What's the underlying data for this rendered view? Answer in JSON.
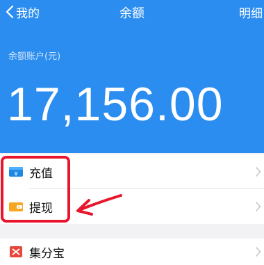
{
  "nav": {
    "back_label": "我的",
    "title": "余额",
    "detail_label": "明细"
  },
  "account": {
    "label": "余额账户(元)",
    "balance": "17,156.00"
  },
  "menu": {
    "items": [
      {
        "label": "充值",
        "icon": "wallet-card-icon"
      },
      {
        "label": "提现",
        "icon": "wallet-icon"
      }
    ]
  },
  "services": {
    "items": [
      {
        "label": "集分宝",
        "icon": "jifenbao-icon"
      }
    ]
  },
  "colors": {
    "header_bg": "#2b8df0",
    "highlight": "#e8162d",
    "page_bg": "#f2f2f4"
  }
}
